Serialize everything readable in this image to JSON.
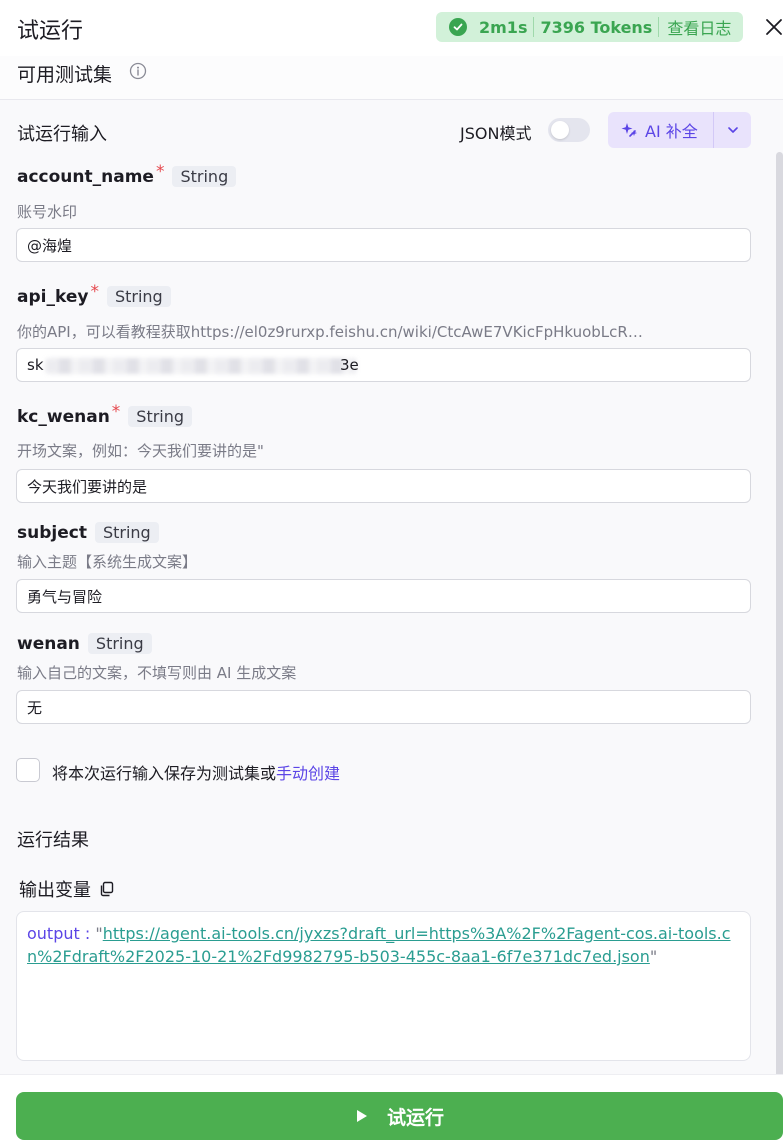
{
  "header": {
    "title": "试运行",
    "status": {
      "duration": "2m1s",
      "tokens": "7396 Tokens",
      "view_logs": "查看日志"
    }
  },
  "test_sets": {
    "label": "可用测试集"
  },
  "input_section": {
    "title": "试运行输入",
    "json_mode_label": "JSON模式",
    "json_mode_on": false,
    "ai_complete_label": "AI 补全"
  },
  "fields": [
    {
      "name": "account_name",
      "required": true,
      "type": "String",
      "description": "账号水印",
      "value": "@海煌"
    },
    {
      "name": "api_key",
      "required": true,
      "type": "String",
      "description": "你的API，可以看教程获取https://el0z9rurxp.feishu.cn/wiki/CtcAwE7VKicFpHkuobLcR…",
      "value": "sk",
      "value_suffix": "3e"
    },
    {
      "name": "kc_wenan",
      "required": true,
      "type": "String",
      "description": "开场文案，例如：今天我们要讲的是\"",
      "value": "今天我们要讲的是"
    },
    {
      "name": "subject",
      "required": false,
      "type": "String",
      "description": "输入主题【系统生成文案】",
      "value": "勇气与冒险"
    },
    {
      "name": "wenan",
      "required": false,
      "type": "String",
      "description": "输入自己的文案，不填写则由 AI 生成文案",
      "value": "无"
    }
  ],
  "save_option": {
    "text": "将本次运行输入保存为测试集或",
    "link": "手动创建",
    "checked": false
  },
  "results": {
    "title": "运行结果",
    "output_title": "输出变量",
    "output_key": "output",
    "output_url": "https://agent.ai-tools.cn/jyxzs?draft_url=https%3A%2F%2Fagent-cos.ai-tools.cn%2Fdraft%2F2025-10-21%2Fd9982795-b503-455c-8aa1-6f7e371dc7ed.json"
  },
  "run_button": {
    "label": "试运行"
  },
  "colors": {
    "primary": "#5b45e6",
    "success": "#4caf50",
    "status_bg": "#d2f1d9"
  },
  "icons": [
    "check-circle-icon",
    "close-icon",
    "info-icon",
    "sparkle-icon",
    "chevron-down-icon",
    "copy-icon",
    "play-icon"
  ]
}
